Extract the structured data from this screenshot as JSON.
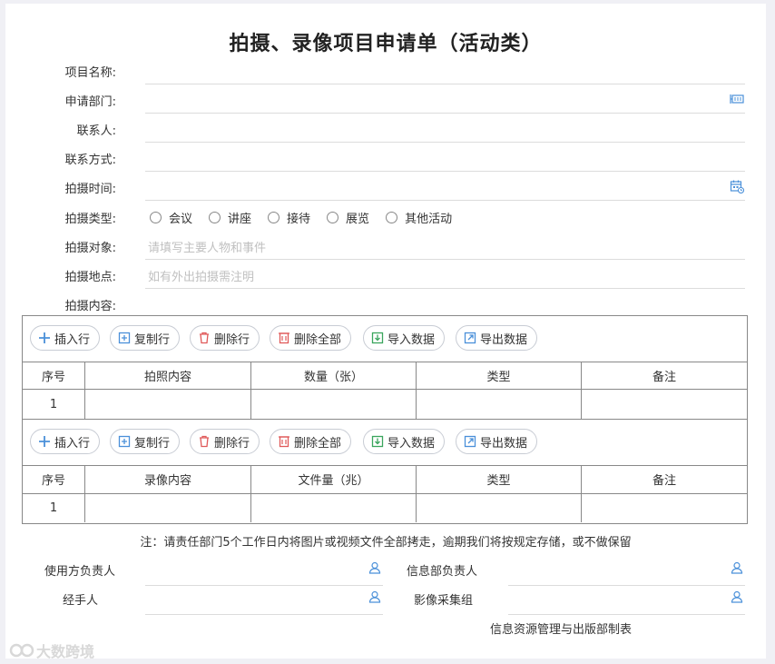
{
  "form": {
    "title": "拍摄、录像项目申请单（活动类）",
    "fields": {
      "project_name": "项目名称:",
      "department": "申请部门:",
      "contact": "联系人:",
      "contact_method": "联系方式:",
      "shoot_time": "拍摄时间:",
      "shoot_type": "拍摄类型:",
      "shoot_target": "拍摄对象:",
      "shoot_target_placeholder": "请填写主要人物和事件",
      "shoot_location": "拍摄地点:",
      "shoot_location_placeholder": "如有外出拍摄需注明",
      "shoot_content": "拍摄内容:"
    },
    "shoot_types": [
      "会议",
      "讲座",
      "接待",
      "展览",
      "其他活动"
    ]
  },
  "toolbar": {
    "insert_row": "插入行",
    "copy_row": "复制行",
    "delete_row": "删除行",
    "delete_all": "删除全部",
    "import_data": "导入数据",
    "export_data": "导出数据"
  },
  "photo_table": {
    "headers": [
      "序号",
      "拍照内容",
      "数量（张）",
      "类型",
      "备注"
    ],
    "rows": [
      [
        "1",
        "",
        "",
        "",
        ""
      ]
    ]
  },
  "video_table": {
    "headers": [
      "序号",
      "录像内容",
      "文件量（兆）",
      "类型",
      "备注"
    ],
    "rows": [
      [
        "1",
        "",
        "",
        "",
        ""
      ]
    ]
  },
  "note": "注：请责任部门5个工作日内将图片或视频文件全部拷走，逾期我们将按规定存储，或不做保留",
  "signatures": {
    "user_lead": "使用方负责人",
    "info_lead": "信息部负责人",
    "handler": "经手人",
    "image_group": "影像采集组"
  },
  "footer": "信息资源管理与出版部制表",
  "watermark": "大数跨境",
  "colors": {
    "accent": "#4a90d9",
    "border": "#888888",
    "line": "#dcdcdc"
  }
}
